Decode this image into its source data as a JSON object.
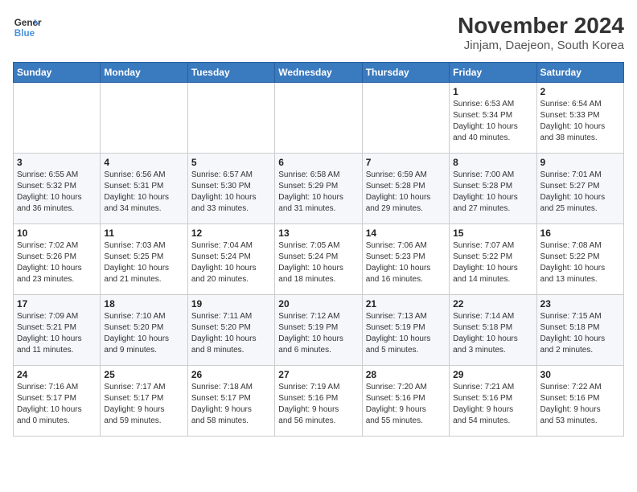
{
  "logo": {
    "line1": "General",
    "line2": "Blue"
  },
  "header": {
    "month": "November 2024",
    "location": "Jinjam, Daejeon, South Korea"
  },
  "weekdays": [
    "Sunday",
    "Monday",
    "Tuesday",
    "Wednesday",
    "Thursday",
    "Friday",
    "Saturday"
  ],
  "weeks": [
    [
      {
        "day": "",
        "info": ""
      },
      {
        "day": "",
        "info": ""
      },
      {
        "day": "",
        "info": ""
      },
      {
        "day": "",
        "info": ""
      },
      {
        "day": "",
        "info": ""
      },
      {
        "day": "1",
        "info": "Sunrise: 6:53 AM\nSunset: 5:34 PM\nDaylight: 10 hours\nand 40 minutes."
      },
      {
        "day": "2",
        "info": "Sunrise: 6:54 AM\nSunset: 5:33 PM\nDaylight: 10 hours\nand 38 minutes."
      }
    ],
    [
      {
        "day": "3",
        "info": "Sunrise: 6:55 AM\nSunset: 5:32 PM\nDaylight: 10 hours\nand 36 minutes."
      },
      {
        "day": "4",
        "info": "Sunrise: 6:56 AM\nSunset: 5:31 PM\nDaylight: 10 hours\nand 34 minutes."
      },
      {
        "day": "5",
        "info": "Sunrise: 6:57 AM\nSunset: 5:30 PM\nDaylight: 10 hours\nand 33 minutes."
      },
      {
        "day": "6",
        "info": "Sunrise: 6:58 AM\nSunset: 5:29 PM\nDaylight: 10 hours\nand 31 minutes."
      },
      {
        "day": "7",
        "info": "Sunrise: 6:59 AM\nSunset: 5:28 PM\nDaylight: 10 hours\nand 29 minutes."
      },
      {
        "day": "8",
        "info": "Sunrise: 7:00 AM\nSunset: 5:28 PM\nDaylight: 10 hours\nand 27 minutes."
      },
      {
        "day": "9",
        "info": "Sunrise: 7:01 AM\nSunset: 5:27 PM\nDaylight: 10 hours\nand 25 minutes."
      }
    ],
    [
      {
        "day": "10",
        "info": "Sunrise: 7:02 AM\nSunset: 5:26 PM\nDaylight: 10 hours\nand 23 minutes."
      },
      {
        "day": "11",
        "info": "Sunrise: 7:03 AM\nSunset: 5:25 PM\nDaylight: 10 hours\nand 21 minutes."
      },
      {
        "day": "12",
        "info": "Sunrise: 7:04 AM\nSunset: 5:24 PM\nDaylight: 10 hours\nand 20 minutes."
      },
      {
        "day": "13",
        "info": "Sunrise: 7:05 AM\nSunset: 5:24 PM\nDaylight: 10 hours\nand 18 minutes."
      },
      {
        "day": "14",
        "info": "Sunrise: 7:06 AM\nSunset: 5:23 PM\nDaylight: 10 hours\nand 16 minutes."
      },
      {
        "day": "15",
        "info": "Sunrise: 7:07 AM\nSunset: 5:22 PM\nDaylight: 10 hours\nand 14 minutes."
      },
      {
        "day": "16",
        "info": "Sunrise: 7:08 AM\nSunset: 5:22 PM\nDaylight: 10 hours\nand 13 minutes."
      }
    ],
    [
      {
        "day": "17",
        "info": "Sunrise: 7:09 AM\nSunset: 5:21 PM\nDaylight: 10 hours\nand 11 minutes."
      },
      {
        "day": "18",
        "info": "Sunrise: 7:10 AM\nSunset: 5:20 PM\nDaylight: 10 hours\nand 9 minutes."
      },
      {
        "day": "19",
        "info": "Sunrise: 7:11 AM\nSunset: 5:20 PM\nDaylight: 10 hours\nand 8 minutes."
      },
      {
        "day": "20",
        "info": "Sunrise: 7:12 AM\nSunset: 5:19 PM\nDaylight: 10 hours\nand 6 minutes."
      },
      {
        "day": "21",
        "info": "Sunrise: 7:13 AM\nSunset: 5:19 PM\nDaylight: 10 hours\nand 5 minutes."
      },
      {
        "day": "22",
        "info": "Sunrise: 7:14 AM\nSunset: 5:18 PM\nDaylight: 10 hours\nand 3 minutes."
      },
      {
        "day": "23",
        "info": "Sunrise: 7:15 AM\nSunset: 5:18 PM\nDaylight: 10 hours\nand 2 minutes."
      }
    ],
    [
      {
        "day": "24",
        "info": "Sunrise: 7:16 AM\nSunset: 5:17 PM\nDaylight: 10 hours\nand 0 minutes."
      },
      {
        "day": "25",
        "info": "Sunrise: 7:17 AM\nSunset: 5:17 PM\nDaylight: 9 hours\nand 59 minutes."
      },
      {
        "day": "26",
        "info": "Sunrise: 7:18 AM\nSunset: 5:17 PM\nDaylight: 9 hours\nand 58 minutes."
      },
      {
        "day": "27",
        "info": "Sunrise: 7:19 AM\nSunset: 5:16 PM\nDaylight: 9 hours\nand 56 minutes."
      },
      {
        "day": "28",
        "info": "Sunrise: 7:20 AM\nSunset: 5:16 PM\nDaylight: 9 hours\nand 55 minutes."
      },
      {
        "day": "29",
        "info": "Sunrise: 7:21 AM\nSunset: 5:16 PM\nDaylight: 9 hours\nand 54 minutes."
      },
      {
        "day": "30",
        "info": "Sunrise: 7:22 AM\nSunset: 5:16 PM\nDaylight: 9 hours\nand 53 minutes."
      }
    ]
  ]
}
